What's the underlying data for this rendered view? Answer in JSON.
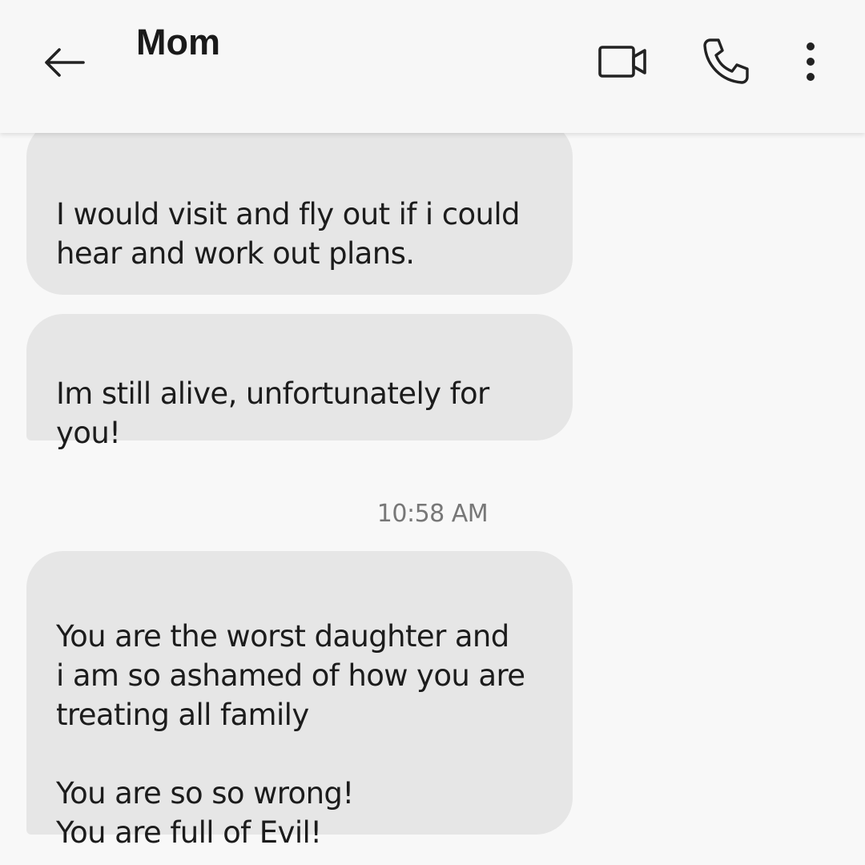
{
  "header": {
    "title": "Mom",
    "icons": {
      "back": "arrow-left-icon",
      "video": "video-camera-icon",
      "phone": "phone-icon",
      "more": "more-vertical-icon"
    }
  },
  "messages": [
    {
      "sender": "Mom",
      "text": "I would visit and fly out if i could\nhear and work out plans."
    },
    {
      "sender": "Mom",
      "text": "Im still alive, unfortunately for\nyou!"
    },
    {
      "sender": "Mom",
      "text": "You are the worst daughter and\ni am so ashamed of how you are\ntreating all family\n\nYou are so so wrong!\nYou are full of Evil!"
    }
  ],
  "timestamp": "10:58 AM",
  "colors": {
    "background": "#f8f8f8",
    "bubble": "#e6e6e6",
    "text": "#1c1c1c",
    "timestamp": "#777777"
  }
}
